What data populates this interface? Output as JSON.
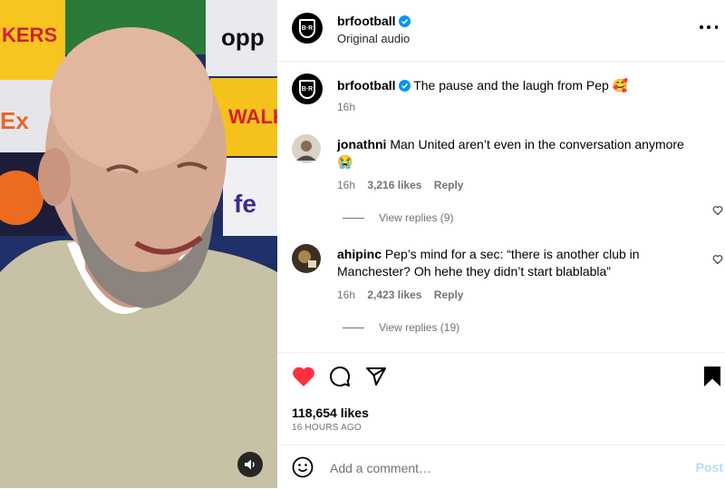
{
  "media": {
    "sound_icon": "speaker-icon"
  },
  "header": {
    "username": "brfootball",
    "subtitle": "Original audio",
    "avatar_text": "B·R"
  },
  "caption": {
    "username": "brfootball",
    "text": "The pause and the laugh from Pep 🥰",
    "time": "16h"
  },
  "comments": [
    {
      "username": "jonathni",
      "text": "Man United aren’t even in the conversation anymore",
      "emoji": "😭",
      "time": "16h",
      "likes": "3,216 likes",
      "reply": "Reply",
      "view_replies": "View replies (9)"
    },
    {
      "username": "ahipinc",
      "text": "Pep’s mind for a sec: “there is another club in Manchester? Oh hehe they didn’t start blablabla”",
      "time": "16h",
      "likes": "2,423 likes",
      "reply": "Reply",
      "view_replies": "View replies (19)"
    }
  ],
  "actions": {
    "likes": "118,654 likes",
    "time_ago": "16 HOURS AGO"
  },
  "add_comment": {
    "placeholder": "Add a comment…",
    "post_label": "Post"
  },
  "colors": {
    "like_red": "#ff3040",
    "verified_blue": "#0095f6",
    "post_disabled": "#b3dbff"
  }
}
